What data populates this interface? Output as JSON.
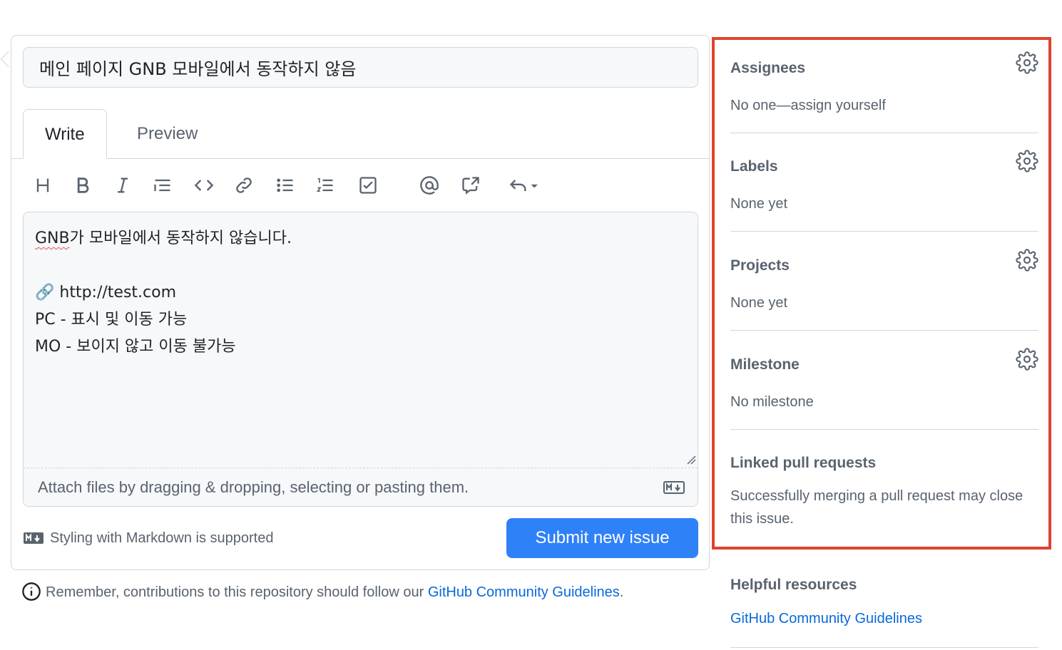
{
  "issue": {
    "title_value": "메인 페이지 GNB 모바일에서 동작하지 않음",
    "tabs": [
      {
        "label": "Write"
      },
      {
        "label": "Preview"
      }
    ],
    "toolbar_icons": [
      "heading-icon",
      "bold-icon",
      "italic-icon",
      "quote-icon",
      "code-icon",
      "link-icon",
      "bulleted-list-icon",
      "numbered-list-icon",
      "task-list-icon",
      "mention-icon",
      "reference-icon",
      "undo-icon"
    ],
    "body": {
      "line1_gnb": "GNB",
      "line1_rest": "가 모바일에서 동작하지 않습니다.",
      "line3": "🔗 http://test.com",
      "line4": "PC - 표시 및 이동 가능",
      "line5": "MO - 보이지 않고 이동 불가능"
    },
    "attach_text": "Attach files by dragging & dropping, selecting or pasting them.",
    "markdown_note": "Styling with Markdown is supported",
    "submit_label": "Submit new issue",
    "remember_text": "Remember, contributions to this repository should follow our ",
    "remember_link": "GitHub Community Guidelines",
    "remember_end": "."
  },
  "sidebar": {
    "assignees": {
      "heading": "Assignees",
      "value": "No one—assign yourself"
    },
    "labels": {
      "heading": "Labels",
      "value": "None yet"
    },
    "projects": {
      "heading": "Projects",
      "value": "None yet"
    },
    "milestone": {
      "heading": "Milestone",
      "value": "No milestone"
    },
    "linked_prs": {
      "heading": "Linked pull requests",
      "value": "Successfully merging a pull request may close this issue."
    },
    "helpful": {
      "heading": "Helpful resources",
      "link": "GitHub Community Guidelines"
    }
  },
  "colors": {
    "accent": "#2f81f7",
    "link": "#0969da",
    "highlight_border": "#e0432f",
    "muted_text": "#59636e"
  }
}
